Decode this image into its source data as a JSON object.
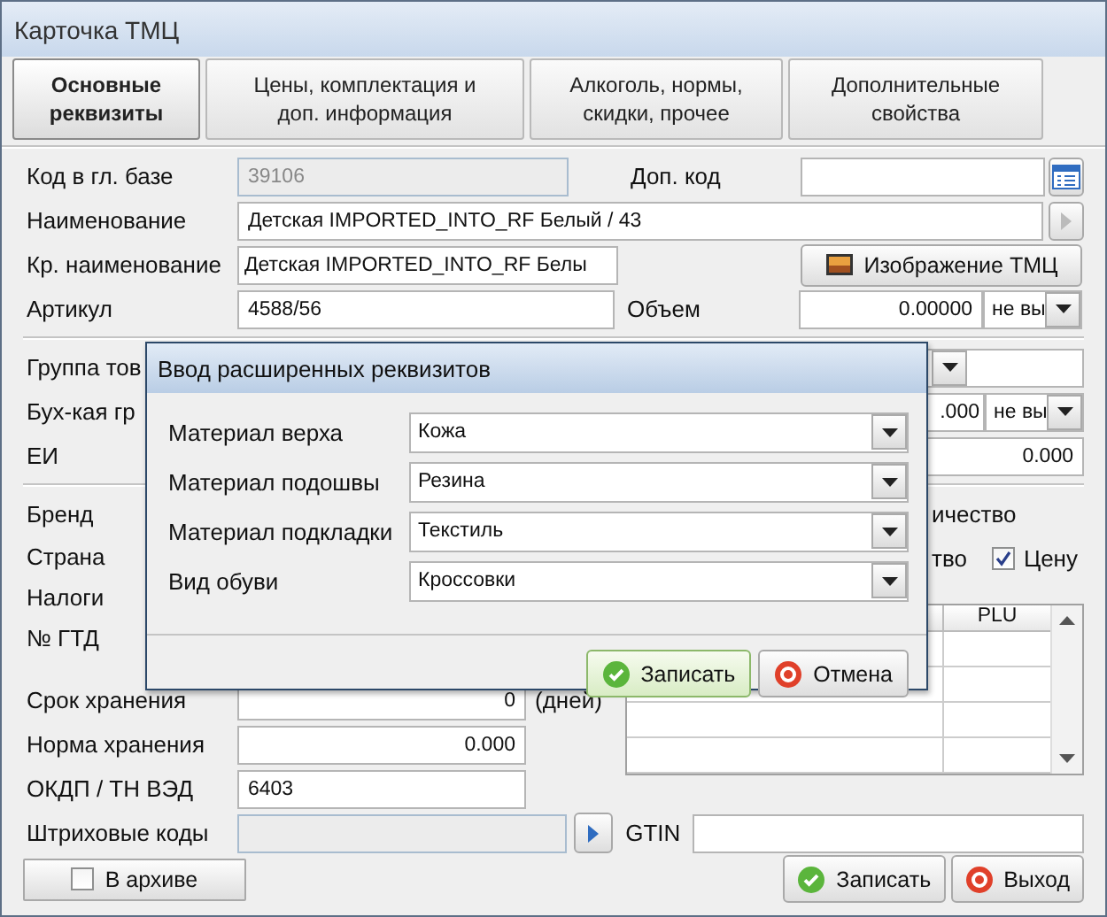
{
  "window": {
    "title": "Карточка ТМЦ"
  },
  "tabs": [
    {
      "label": "Основные\nреквизиты",
      "selected": true
    },
    {
      "label": "Цены, комплектация и\nдоп.  информация",
      "selected": false
    },
    {
      "label": "Алкоголь, нормы,\nскидки, прочее",
      "selected": false
    },
    {
      "label": "Дополнительные\nсвойства",
      "selected": false
    }
  ],
  "form": {
    "code_label": "Код в гл. базе",
    "code_value": "39106",
    "extra_code_label": "Доп. код",
    "name_label": "Наименование",
    "name_value": "Детская IMPORTED_INTO_RF Белый / 43",
    "short_name_label": "Кр. наименование",
    "short_name_value": "Детская IMPORTED_INTO_RF Белы",
    "image_button": "Изображение ТМЦ",
    "article_label": "Артикул",
    "article_value": "4588/56",
    "volume_label": "Объем",
    "volume_value": "0.00000",
    "volume_unit": "не вы",
    "group_label": "Группа тов",
    "accounting_label": "Бух-кая гр",
    "accounting_value": ".000",
    "accounting_unit": "не вы",
    "unit_label": "ЕИ",
    "unit_value": "0.000",
    "brand_label": "Бренд",
    "country_label": "Страна",
    "taxes_label": "Налоги",
    "gtd_label": "№ ГТД",
    "quantity_text": "ичество",
    "partial_text": "тво",
    "price_check": {
      "label": "Цену",
      "checked": true
    },
    "grid": {
      "columns": [
        "PLU"
      ]
    },
    "shelf_life_label": "Срок хранения",
    "shelf_life_value": "0",
    "shelf_life_unit": "(дней)",
    "storage_norm_label": "Норма хранения",
    "storage_norm_value": "0.000",
    "okdp_label": "ОКДП / ТН ВЭД",
    "okdp_value": "6403",
    "barcodes_label": "Штриховые коды",
    "gtin_label": "GTIN",
    "archive": {
      "label": "В архиве",
      "checked": false
    }
  },
  "buttons": [
    {
      "label": "Записать",
      "kind": "save"
    },
    {
      "label": "Выход",
      "kind": "exit"
    }
  ],
  "dialog": {
    "title": "Ввод расширенных реквизитов",
    "fields": [
      {
        "label": "Материал верха",
        "value": "Кожа"
      },
      {
        "label": "Материал подошвы",
        "value": "Резина"
      },
      {
        "label": "Материал подкладки",
        "value": "Текстиль"
      },
      {
        "label": "Вид обуви",
        "value": "Кроссовки"
      }
    ],
    "buttons": [
      {
        "label": "Записать",
        "kind": "save"
      },
      {
        "label": "Отмена",
        "kind": "cancel"
      }
    ]
  }
}
